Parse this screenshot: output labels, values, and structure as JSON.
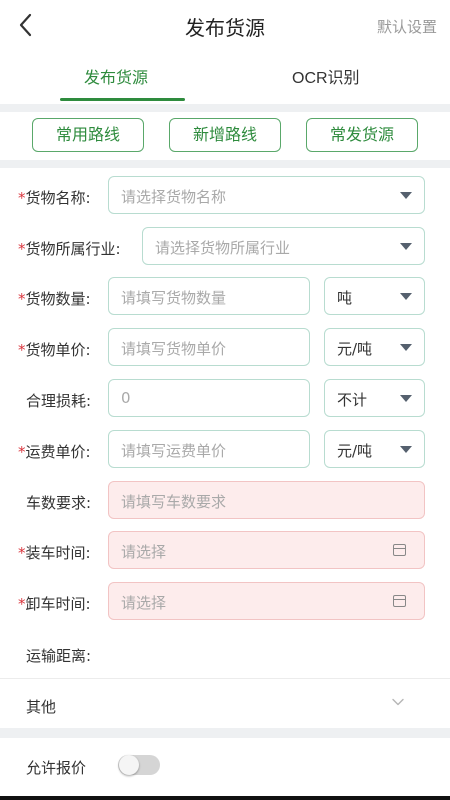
{
  "header": {
    "title": "发布货源",
    "default_settings": "默认设置"
  },
  "tabs": [
    {
      "label": "发布货源",
      "active": true
    },
    {
      "label": "OCR识别",
      "active": false
    }
  ],
  "routes": {
    "common": "常用路线",
    "add": "新增路线",
    "frequent": "常发货源"
  },
  "form": {
    "required_mark": "*",
    "goods_name": {
      "label": "货物名称:",
      "placeholder": "请选择货物名称"
    },
    "industry": {
      "label": "货物所属行业:",
      "placeholder": "请选择货物所属行业"
    },
    "quantity": {
      "label": "货物数量:",
      "placeholder": "请填写货物数量",
      "unit": "吨"
    },
    "unit_price": {
      "label": "货物单价:",
      "placeholder": "请填写货物单价",
      "unit": "元/吨"
    },
    "loss": {
      "label": "合理损耗:",
      "value": "0",
      "unit": "不计"
    },
    "freight_price": {
      "label": "运费单价:",
      "placeholder": "请填写运费单价",
      "unit": "元/吨"
    },
    "vehicles": {
      "label": "车数要求:",
      "placeholder": "请填写车数要求"
    },
    "load_time": {
      "label": "装车时间:",
      "placeholder": "请选择"
    },
    "unload_time": {
      "label": "卸车时间:",
      "placeholder": "请选择"
    },
    "distance": {
      "label": "运输距离:"
    }
  },
  "other": {
    "label": "其他"
  },
  "allow_bid": {
    "label": "允许报价",
    "enabled": false
  },
  "colors": {
    "accent": "#2e8b3d",
    "required": "#d9363e",
    "field_border": "#b8dcd0",
    "invalid_bg": "#fdecec"
  }
}
